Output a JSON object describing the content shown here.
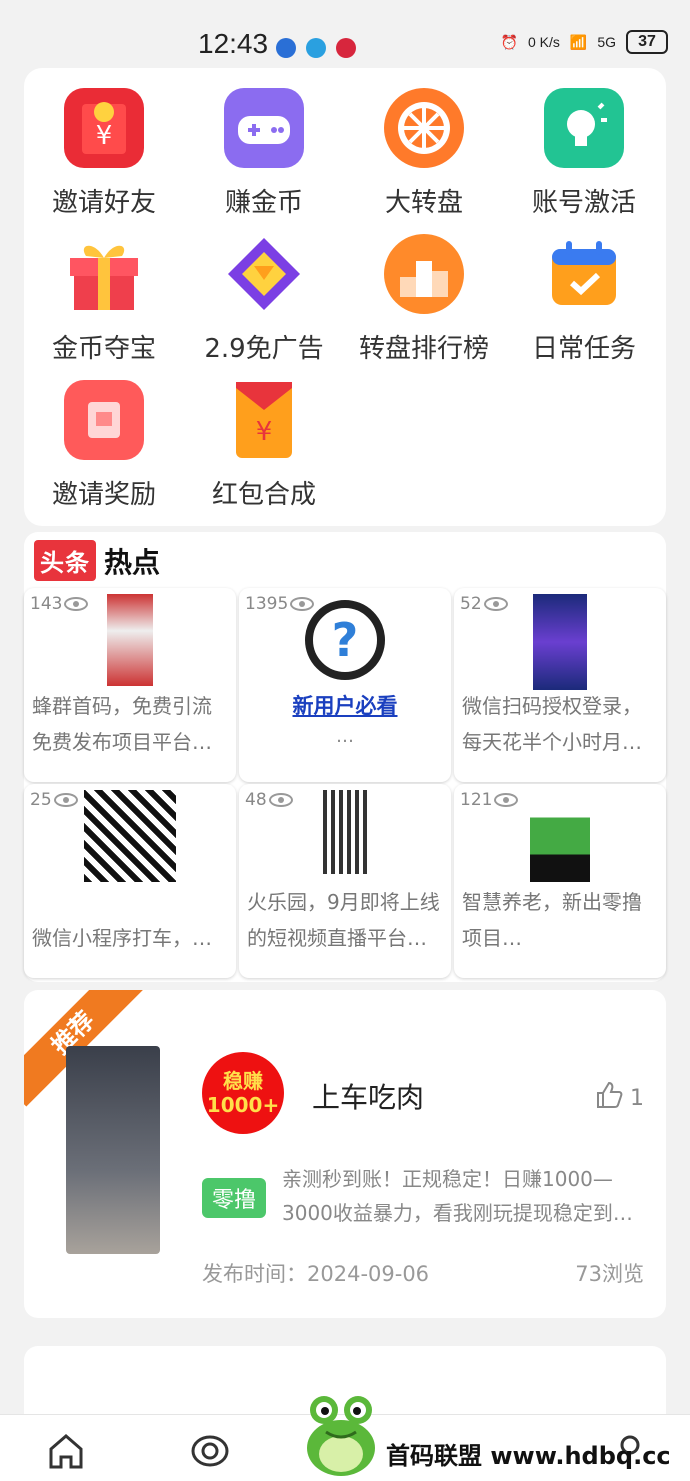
{
  "status_bar": {
    "time": "12:43",
    "net_speed": "0 K/s",
    "network": "5G",
    "battery": "37"
  },
  "grid": [
    {
      "label": "邀请好友",
      "icon": "red-envelope-icon"
    },
    {
      "label": "赚金币",
      "icon": "gamepad-icon"
    },
    {
      "label": "大转盘",
      "icon": "wheel-icon"
    },
    {
      "label": "账号激活",
      "icon": "lightbulb-icon"
    },
    {
      "label": "金币夺宝",
      "icon": "gift-box-icon"
    },
    {
      "label": "2.9免广告",
      "icon": "diamond-icon"
    },
    {
      "label": "转盘排行榜",
      "icon": "podium-icon"
    },
    {
      "label": "日常任务",
      "icon": "calendar-check-icon"
    },
    {
      "label": "邀请奖励",
      "icon": "reward-icon"
    },
    {
      "label": "红包合成",
      "icon": "red-packet-icon"
    }
  ],
  "hot": {
    "logo": "头条",
    "title": "热点",
    "tiles": [
      {
        "views": "143",
        "text": "蜂群首码，免费引流免费发布项目平台…"
      },
      {
        "views": "1395",
        "text": "新用户必看",
        "sub": "…"
      },
      {
        "views": "52",
        "text": "微信扫码授权登录，每天花半个小时月…"
      },
      {
        "views": "25",
        "text": "微信小程序打车，…"
      },
      {
        "views": "48",
        "text": "火乐园，9月即将上线的短视频直播平台…"
      },
      {
        "views": "121",
        "text": "智慧养老，新出零撸项目…"
      }
    ]
  },
  "recommend": {
    "ribbon": "推荐",
    "avatar_text": [
      "稳赚",
      "1000+"
    ],
    "title": "上车吃肉",
    "likes": "1",
    "tag": "零撸",
    "desc": "亲测秒到账！正规稳定！日赚1000—3000收益暴力，看我刚玩提现稳定到…",
    "date": "发布时间：2024-09-06",
    "views": "73浏览"
  },
  "watermark": "首码联盟 www.hdbq.cc",
  "colors": {
    "accent_red": "#e8343c",
    "ribbon": "#f07a20",
    "tag_green": "#4cc76a"
  }
}
